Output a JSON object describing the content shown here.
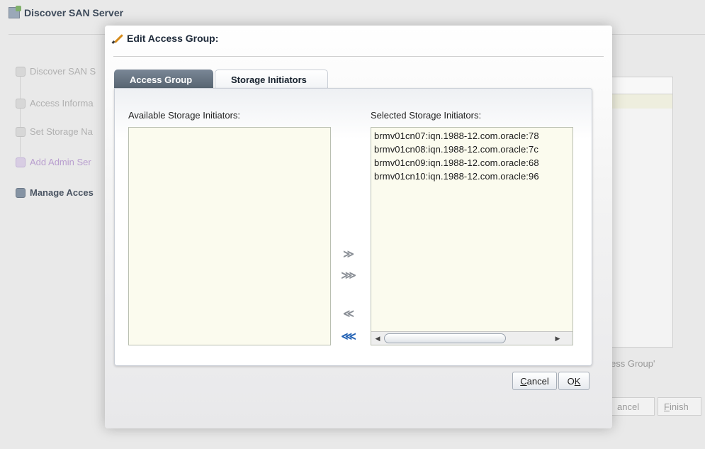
{
  "background_wizard": {
    "title": "Discover SAN Server",
    "steps": [
      {
        "label": "Discover SAN S",
        "state": "disabled"
      },
      {
        "label": "Access Informa",
        "state": "disabled"
      },
      {
        "label": "Set Storage Na",
        "state": "disabled"
      },
      {
        "label": "Add Admin Ser",
        "state": "visited"
      },
      {
        "label": "Manage Acces",
        "state": "current"
      }
    ],
    "hint_text": "ess Group'",
    "cancel_label_rest": "ancel",
    "cancel_label_first": "C",
    "finish_label_first": "F",
    "finish_label_rest": "inish"
  },
  "dialog": {
    "title": "Edit Access Group:",
    "tabs": [
      {
        "label": "Access Group",
        "selected": false
      },
      {
        "label": "Storage Initiators",
        "selected": true
      }
    ],
    "available_label": "Available Storage Initiators:",
    "available_items": [],
    "selected_label": "Selected Storage Initiators:",
    "selected_items": [
      "brmv01cn07:iqn.1988-12.com.oracle:78",
      "brmv01cn08:iqn.1988-12.com.oracle:7c",
      "brmv01cn09:iqn.1988-12.com.oracle:68",
      "brmv01cn10:iqn.1988-12.com.oracle:96"
    ],
    "shuttle": {
      "move": "≫",
      "move_all": "⋙",
      "remove": "≪",
      "remove_all": "⋘"
    },
    "cancel": {
      "mnemonic": "C",
      "rest": "ancel"
    },
    "ok": {
      "mnemonic": "K",
      "prefix": "O"
    }
  },
  "colors": {
    "tab_underline": "#d8232a",
    "list_background": "#fbfbee",
    "remove_all_icon": "#2463b5"
  },
  "icons": [
    "wizard-icon",
    "pencil-icon",
    "scroll-left-icon",
    "scroll-right-icon"
  ]
}
